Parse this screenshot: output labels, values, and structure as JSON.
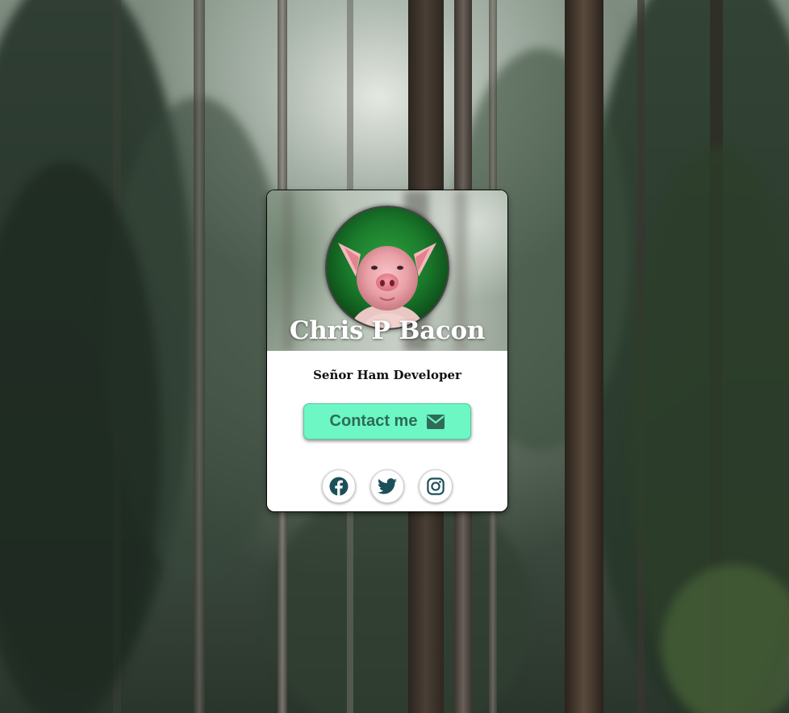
{
  "profile": {
    "name": "Chris P Bacon",
    "title": "Señor Ham Developer",
    "avatar_icon": "pig-avatar"
  },
  "contact": {
    "label": "Contact me",
    "icon": "envelope-icon"
  },
  "socials": [
    {
      "name": "facebook",
      "icon": "facebook-icon"
    },
    {
      "name": "twitter",
      "icon": "twitter-icon"
    },
    {
      "name": "instagram",
      "icon": "instagram-icon"
    }
  ],
  "colors": {
    "button_bg": "#6cf7c5",
    "button_text": "#2f6b57",
    "icon_color": "#1d4f5a",
    "card_bg": "#ffffff"
  }
}
